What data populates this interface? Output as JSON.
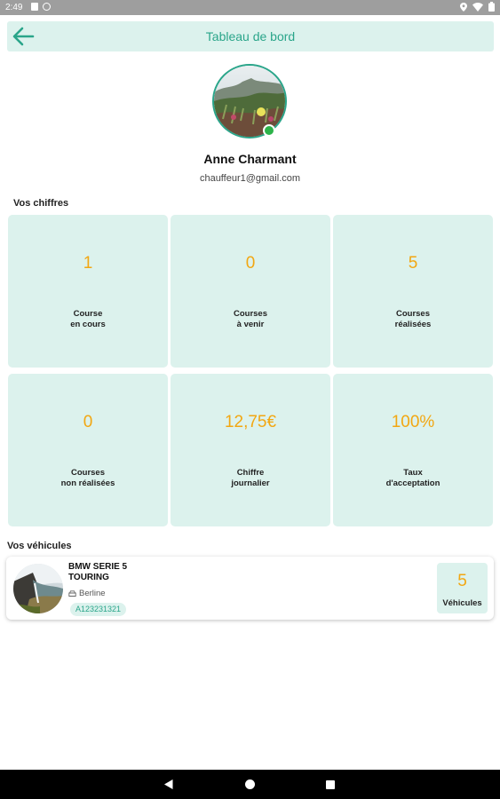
{
  "status_bar": {
    "time": "2:49",
    "left_icons": [
      "sim-card-icon",
      "sync-blocked-icon"
    ],
    "right_icons": [
      "location-icon",
      "wifi-icon",
      "battery-icon"
    ]
  },
  "header": {
    "title": "Tableau de bord",
    "back_icon": "arrow-left-icon"
  },
  "profile": {
    "name": "Anne Charmant",
    "email": "chauffeur1@gmail.com",
    "online": true
  },
  "stats_section": {
    "title": "Vos chiffres",
    "cards": [
      {
        "value": "1",
        "label": "Course\nen cours"
      },
      {
        "value": "0",
        "label": "Courses\nà venir"
      },
      {
        "value": "5",
        "label": "Courses\nréalisées"
      },
      {
        "value": "0",
        "label": "Courses\nnon réalisées"
      },
      {
        "value": "12,75€",
        "label": "Chiffre\njournalier"
      },
      {
        "value": "100%",
        "label": "Taux\nd'acceptation"
      }
    ]
  },
  "vehicles_section": {
    "title": "Vos véhicules",
    "vehicle": {
      "name": "BMW SERIE 5 TOURING",
      "type": "Berline",
      "type_icon": "car-icon",
      "plate": "A123231321"
    },
    "count": {
      "value": "5",
      "label": "Véhicules"
    }
  },
  "colors": {
    "accent": "#2aa58a",
    "card_bg": "#dcf2ed",
    "value": "#f2a712",
    "online": "#2db34a"
  },
  "nav_bar": {
    "icons": [
      "nav-back-icon",
      "nav-home-icon",
      "nav-recents-icon"
    ]
  }
}
